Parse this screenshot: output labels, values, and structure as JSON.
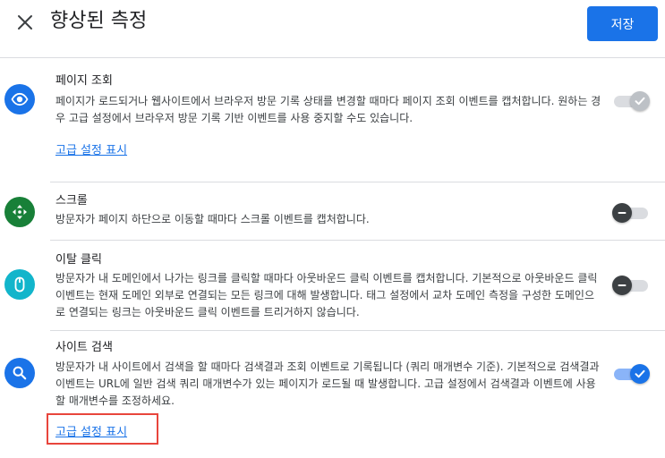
{
  "header": {
    "close_icon": "close-icon",
    "title": "향상된 측정",
    "save_label": "저장"
  },
  "colors": {
    "accent": "#1a73e8",
    "highlight": "#e8453c",
    "toggle_off_knob": "#3c4043",
    "toggle_off_track": "#dadce0"
  },
  "sections": [
    {
      "icon": "eye-icon",
      "title": "페이지 조회",
      "description": "페이지가 로드되거나 웹사이트에서 브라우저 방문 기록 상태를 변경할 때마다 페이지 조회 이벤트를 캡처합니다. 원하는 경우 고급 설정에서 브라우저 방문 기록 기반 이벤트를 사용 중지할 수도 있습니다.",
      "link": "고급 설정 표시",
      "toggle": "on-disabled"
    },
    {
      "icon": "scroll-arrows-icon",
      "title": "스크롤",
      "description": "방문자가 페이지 하단으로 이동할 때마다 스크롤 이벤트를 캡처합니다.",
      "toggle": "off"
    },
    {
      "icon": "mouse-icon",
      "title": "이탈 클릭",
      "description": "방문자가 내 도메인에서 나가는 링크를 클릭할 때마다 아웃바운드 클릭 이벤트를 캡처합니다. 기본적으로 아웃바운드 클릭 이벤트는 현재 도메인 외부로 연결되는 모든 링크에 대해 발생합니다. 태그 설정에서 교차 도메인 측정을 구성한 도메인으로 연결되는 링크는 아웃바운드 클릭 이벤트를 트리거하지 않습니다.",
      "toggle": "off"
    },
    {
      "icon": "search-icon",
      "title": "사이트 검색",
      "description": "방문자가 내 사이트에서 검색을 할 때마다 검색결과 조회 이벤트로 기록됩니다 (쿼리 매개변수 기준). 기본적으로 검색결과 이벤트는 URL에 일반 검색 쿼리 매개변수가 있는 페이지가 로드될 때 발생합니다. 고급 설정에서 검색결과 이벤트에 사용할 매개변수를 조정하세요.",
      "link": "고급 설정 표시",
      "toggle": "on"
    }
  ]
}
